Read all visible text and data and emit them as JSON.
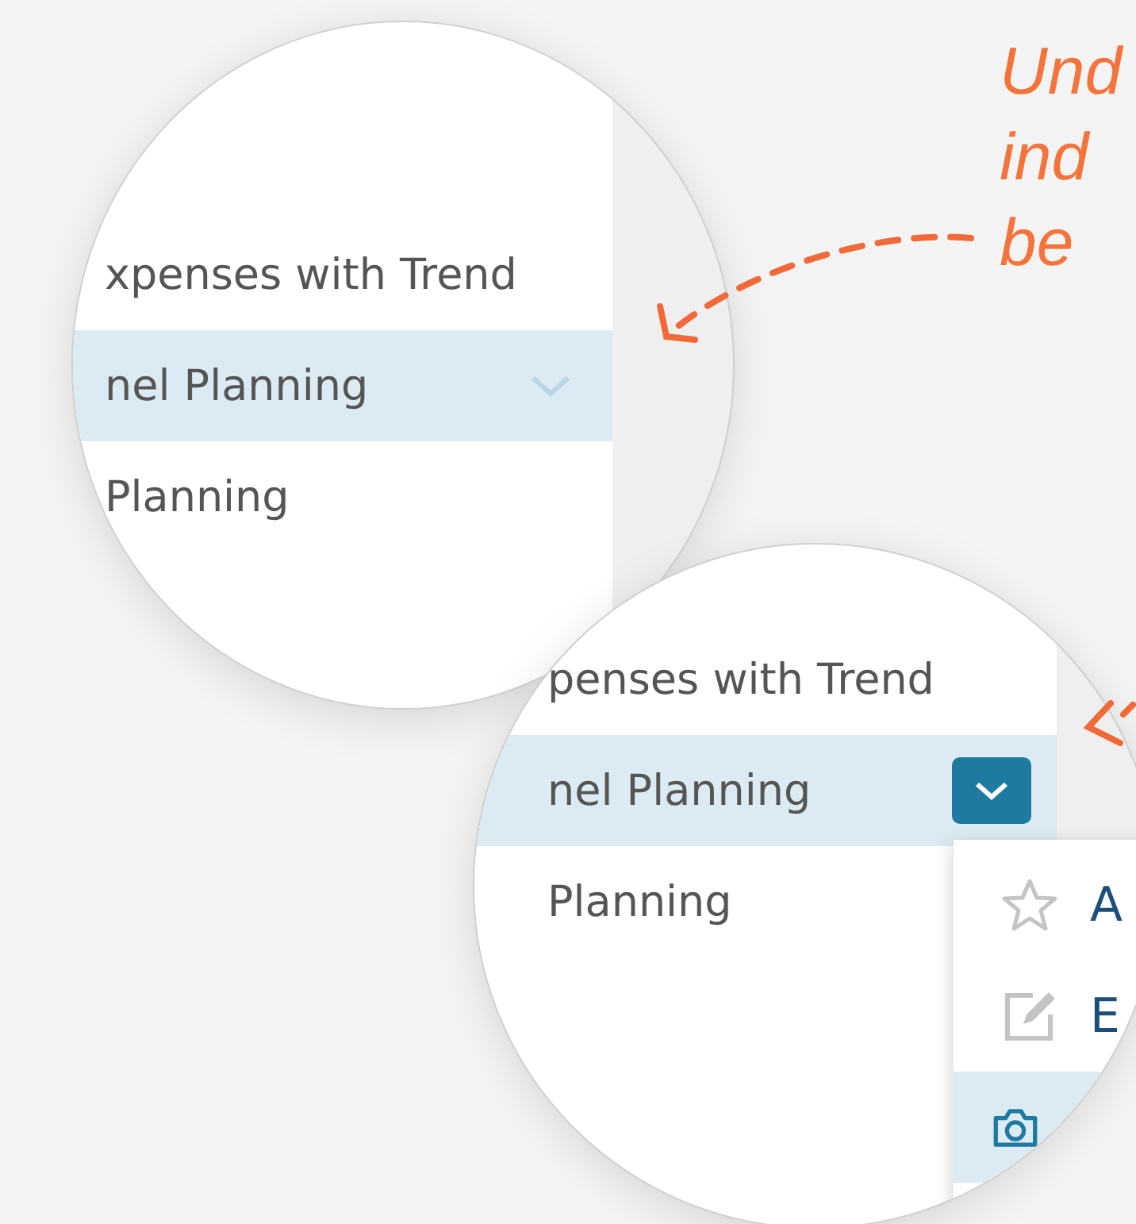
{
  "annotation": {
    "lines": [
      "Und",
      "ind",
      "be"
    ]
  },
  "zoom_views": [
    {
      "rows": [
        {
          "label": "xpenses with Trend",
          "selected": false,
          "kind": "plain"
        },
        {
          "label": "nel Planning",
          "selected": true,
          "kind": "chevron"
        },
        {
          "label": "Planning",
          "selected": false,
          "kind": "plain"
        }
      ]
    },
    {
      "rows": [
        {
          "label": "penses with Trend",
          "selected": false,
          "kind": "plain"
        },
        {
          "label": "nel Planning",
          "selected": true,
          "kind": "button"
        },
        {
          "label": "Planning",
          "selected": false,
          "kind": "plain"
        }
      ],
      "menu": [
        {
          "kind": "star",
          "label": "A",
          "selected": false
        },
        {
          "kind": "pencil",
          "label": "E",
          "selected": false
        },
        {
          "kind": "camera",
          "selected": true
        }
      ]
    }
  ]
}
